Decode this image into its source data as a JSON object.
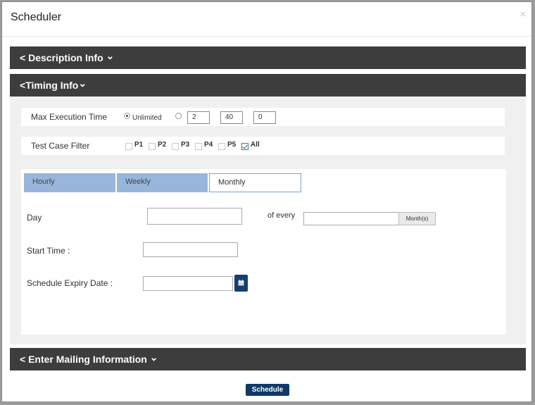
{
  "dialog": {
    "title": "Scheduler",
    "close_glyph": "×"
  },
  "sections": {
    "description": {
      "prefix": "<",
      "label": " Description Info ",
      "suffix": "⌄"
    },
    "timing": {
      "prefix": "<",
      "label": "Timing Info",
      "suffix": "⌄"
    },
    "mailing": {
      "prefix": "<",
      "label": " Enter Mailing Information ",
      "suffix": "⌄"
    }
  },
  "max_execution": {
    "label": "Max Execution Time",
    "unlimited_label": "Unlimited",
    "unlimited_selected": true,
    "hours": "2",
    "minutes": "40",
    "seconds": "0"
  },
  "test_case_filter": {
    "label": "Test Case Filter",
    "options": [
      {
        "label": "P1",
        "checked": false
      },
      {
        "label": "P2",
        "checked": false
      },
      {
        "label": "P3",
        "checked": false
      },
      {
        "label": "P4",
        "checked": false
      },
      {
        "label": "P5",
        "checked": false
      },
      {
        "label": "All",
        "checked": true
      }
    ]
  },
  "schedule": {
    "tabs": [
      {
        "label": "Hourly",
        "active": false
      },
      {
        "label": "Weekly",
        "active": false
      },
      {
        "label": "Monthly",
        "active": true
      }
    ],
    "day_label": "Day",
    "of_every_label": "of every",
    "month_unit": "Month(s)",
    "start_time_label": "Start Time :",
    "expiry_label": "Schedule Expiry Date :"
  },
  "icons": {
    "calendar": "calendar-icon",
    "close": "close-icon",
    "chevron_left": "chevron-left-icon",
    "chevron_down": "chevron-down-icon"
  },
  "colors": {
    "section_bar": "#3d3d3d",
    "tab_inactive": "#98b6dc",
    "primary_button": "#0f3a68"
  },
  "footer": {
    "schedule_label": "Schedule"
  }
}
